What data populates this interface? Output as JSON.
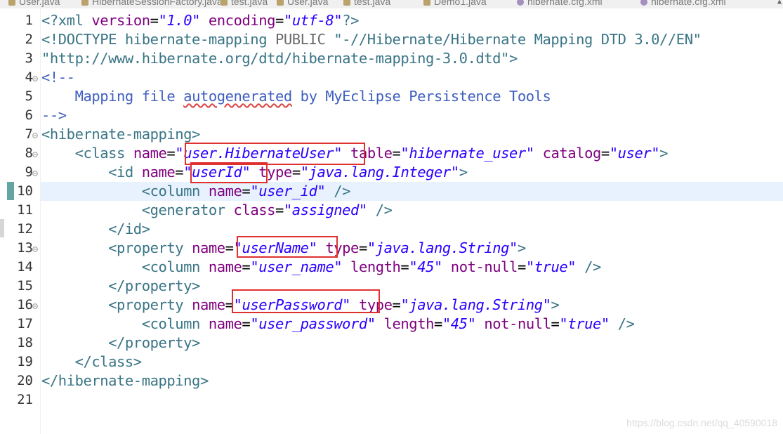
{
  "tabs": [
    {
      "label": "User.java",
      "icon": "java-file-icon"
    },
    {
      "label": "HibernateSessionFactory.java",
      "icon": "java-file-icon"
    },
    {
      "label": "test.java",
      "icon": "java-file-icon"
    },
    {
      "label": "User.java",
      "icon": "java-file-icon"
    },
    {
      "label": "test.java",
      "icon": "java-file-icon"
    },
    {
      "label": "Demo1.java",
      "icon": "java-file-icon"
    },
    {
      "label": "hibernate.cfg.xml",
      "icon": "xml-file-icon"
    },
    {
      "label": "hibernate.cfg.xml",
      "icon": "xml-file-icon"
    }
  ],
  "editor": {
    "current_line": 10,
    "lines": [
      {
        "n": "1",
        "fold": false,
        "tokens": [
          [
            "dec",
            "<?xml "
          ],
          [
            "attr",
            "version"
          ],
          [
            "eq",
            "="
          ],
          [
            "val",
            "\"1.0\""
          ],
          [
            "eq",
            " "
          ],
          [
            "attr",
            "encoding"
          ],
          [
            "eq",
            "="
          ],
          [
            "val",
            "\"utf-8\""
          ],
          [
            "dec",
            "?>"
          ]
        ]
      },
      {
        "n": "2",
        "fold": false,
        "tokens": [
          [
            "doc",
            "<!DOCTYPE hibernate-mapping "
          ],
          [
            "pub",
            "PUBLIC "
          ],
          [
            "doc",
            "\"-//Hibernate/Hibernate Mapping DTD 3.0//EN\""
          ]
        ]
      },
      {
        "n": "3",
        "fold": false,
        "tokens": [
          [
            "doc",
            "\"http://www.hibernate.org/dtd/hibernate-mapping-3.0.dtd\">"
          ]
        ]
      },
      {
        "n": "4",
        "fold": true,
        "tokens": [
          [
            "com",
            "<!--"
          ]
        ]
      },
      {
        "n": "5",
        "fold": false,
        "tokens": [
          [
            "com",
            "    Mapping file "
          ],
          [
            "spell",
            "autogenerated"
          ],
          [
            "com",
            " by MyEclipse Persistence Tools"
          ]
        ]
      },
      {
        "n": "6",
        "fold": false,
        "tokens": [
          [
            "com",
            "-->"
          ]
        ]
      },
      {
        "n": "7",
        "fold": true,
        "tokens": [
          [
            "tag",
            "<hibernate-mapping>"
          ]
        ]
      },
      {
        "n": "8",
        "fold": true,
        "tokens": [
          [
            "tag",
            "    <class "
          ],
          [
            "attr",
            "name"
          ],
          [
            "eq",
            "="
          ],
          [
            "val",
            "\"user.HibernateUser\""
          ],
          [
            "eq",
            " "
          ],
          [
            "attr",
            "table"
          ],
          [
            "eq",
            "="
          ],
          [
            "val",
            "\"hibernate_user\""
          ],
          [
            "eq",
            " "
          ],
          [
            "attr",
            "catalog"
          ],
          [
            "eq",
            "="
          ],
          [
            "val",
            "\"user\""
          ],
          [
            "tag",
            ">"
          ]
        ]
      },
      {
        "n": "9",
        "fold": true,
        "tokens": [
          [
            "tag",
            "        <id "
          ],
          [
            "attr",
            "name"
          ],
          [
            "eq",
            "="
          ],
          [
            "val",
            "\"userId\""
          ],
          [
            "eq",
            " "
          ],
          [
            "attr",
            "type"
          ],
          [
            "eq",
            "="
          ],
          [
            "val",
            "\"java.lang.Integer\""
          ],
          [
            "tag",
            ">"
          ]
        ]
      },
      {
        "n": "10",
        "fold": false,
        "tokens": [
          [
            "tag",
            "            <column "
          ],
          [
            "attr",
            "name"
          ],
          [
            "eq",
            "="
          ],
          [
            "val",
            "\"user_id\""
          ],
          [
            "eq",
            " "
          ],
          [
            "tag",
            "/>"
          ]
        ]
      },
      {
        "n": "11",
        "fold": false,
        "tokens": [
          [
            "tag",
            "            <generator "
          ],
          [
            "attr",
            "class"
          ],
          [
            "eq",
            "="
          ],
          [
            "val",
            "\"assigned\""
          ],
          [
            "eq",
            " "
          ],
          [
            "tag",
            "/>"
          ]
        ]
      },
      {
        "n": "12",
        "fold": false,
        "tokens": [
          [
            "tag",
            "        </id>"
          ]
        ]
      },
      {
        "n": "13",
        "fold": true,
        "tokens": [
          [
            "tag",
            "        <property "
          ],
          [
            "attr",
            "name"
          ],
          [
            "eq",
            "="
          ],
          [
            "val",
            "\"userName\""
          ],
          [
            "eq",
            " "
          ],
          [
            "attr",
            "type"
          ],
          [
            "eq",
            "="
          ],
          [
            "val",
            "\"java.lang.String\""
          ],
          [
            "tag",
            ">"
          ]
        ]
      },
      {
        "n": "14",
        "fold": false,
        "tokens": [
          [
            "tag",
            "            <column "
          ],
          [
            "attr",
            "name"
          ],
          [
            "eq",
            "="
          ],
          [
            "val",
            "\"user_name\""
          ],
          [
            "eq",
            " "
          ],
          [
            "attr",
            "length"
          ],
          [
            "eq",
            "="
          ],
          [
            "val",
            "\"45\""
          ],
          [
            "eq",
            " "
          ],
          [
            "attr",
            "not-null"
          ],
          [
            "eq",
            "="
          ],
          [
            "val",
            "\"true\""
          ],
          [
            "eq",
            " "
          ],
          [
            "tag",
            "/>"
          ]
        ]
      },
      {
        "n": "15",
        "fold": false,
        "tokens": [
          [
            "tag",
            "        </property>"
          ]
        ]
      },
      {
        "n": "16",
        "fold": true,
        "tokens": [
          [
            "tag",
            "        <property "
          ],
          [
            "attr",
            "name"
          ],
          [
            "eq",
            "="
          ],
          [
            "val",
            "\"userPassword\""
          ],
          [
            "eq",
            " "
          ],
          [
            "attr",
            "type"
          ],
          [
            "eq",
            "="
          ],
          [
            "val",
            "\"java.lang.String\""
          ],
          [
            "tag",
            ">"
          ]
        ]
      },
      {
        "n": "17",
        "fold": false,
        "tokens": [
          [
            "tag",
            "            <column "
          ],
          [
            "attr",
            "name"
          ],
          [
            "eq",
            "="
          ],
          [
            "val",
            "\"user_password\""
          ],
          [
            "eq",
            " "
          ],
          [
            "attr",
            "length"
          ],
          [
            "eq",
            "="
          ],
          [
            "val",
            "\"45\""
          ],
          [
            "eq",
            " "
          ],
          [
            "attr",
            "not-null"
          ],
          [
            "eq",
            "="
          ],
          [
            "val",
            "\"true\""
          ],
          [
            "eq",
            " "
          ],
          [
            "tag",
            "/>"
          ]
        ]
      },
      {
        "n": "18",
        "fold": false,
        "tokens": [
          [
            "tag",
            "        </property>"
          ]
        ]
      },
      {
        "n": "19",
        "fold": false,
        "tokens": [
          [
            "tag",
            "    </class>"
          ]
        ]
      },
      {
        "n": "20",
        "fold": false,
        "tokens": [
          [
            "tag",
            "</hibernate-mapping>"
          ]
        ]
      },
      {
        "n": "21",
        "fold": false,
        "tokens": []
      }
    ]
  },
  "watermark": "https://blog.csdn.net/qq_40590018"
}
